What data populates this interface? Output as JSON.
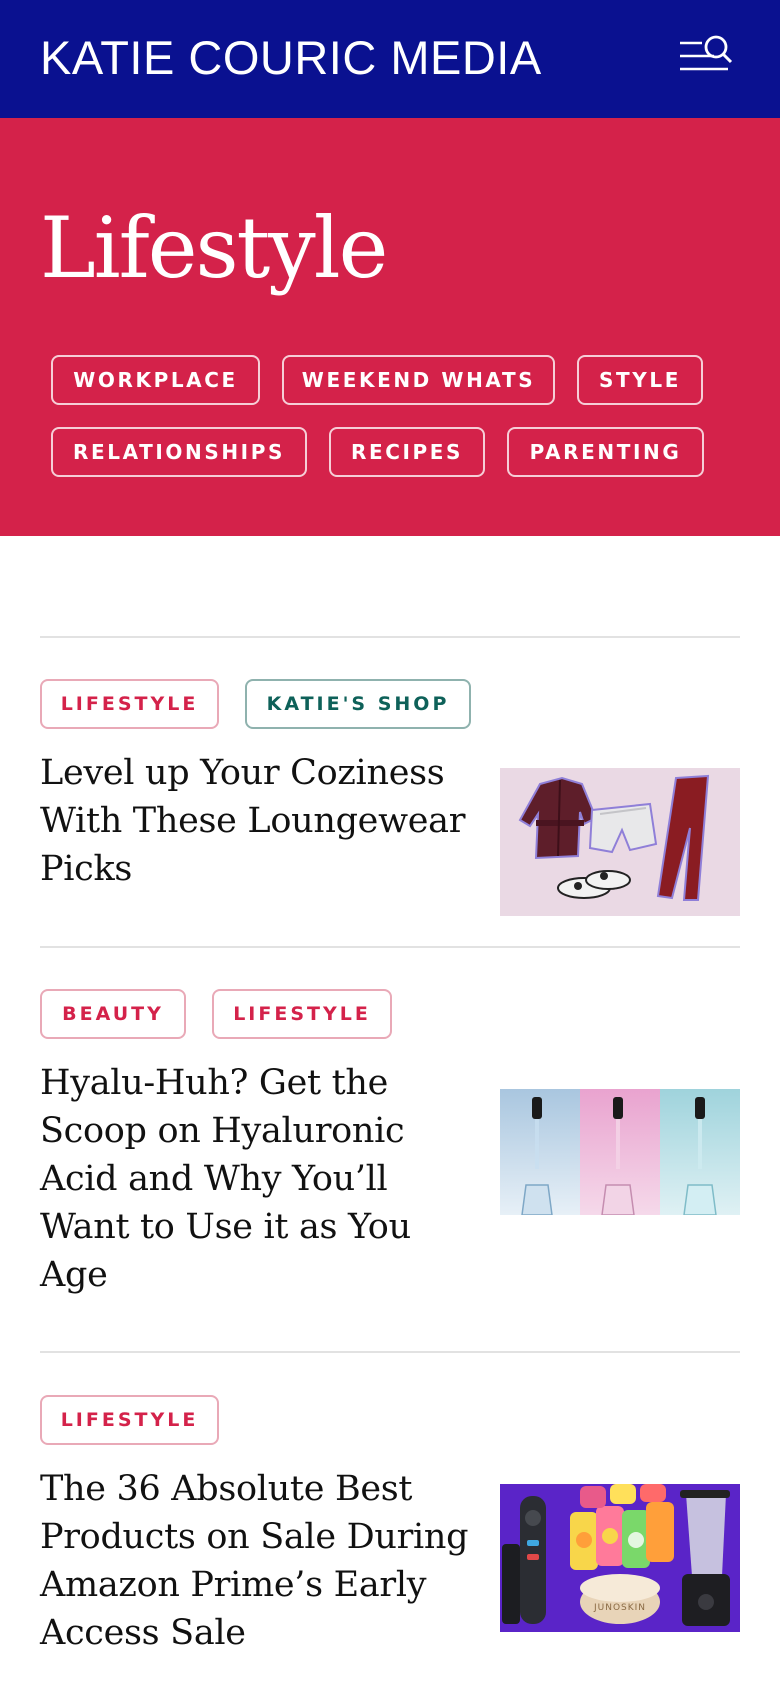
{
  "header": {
    "logo_text": "KATIE COURIC MEDIA",
    "menu_icon": "menu-search-icon",
    "background": "#0a1190"
  },
  "hero": {
    "title": "Lifestyle",
    "background": "#d4224a",
    "categories": [
      "WORKPLACE",
      "WEEKEND WHATS",
      "STYLE",
      "RELATIONSHIPS",
      "RECIPES",
      "PARENTING"
    ]
  },
  "articles": [
    {
      "tags": [
        "LIFESTYLE",
        "KATIE'S SHOP"
      ],
      "title": "Level up Your Coziness With These Loungewear Picks",
      "image": "loungewear-collage"
    },
    {
      "tags": [
        "BEAUTY",
        "LIFESTYLE"
      ],
      "title": "Hyalu-Huh? Get the Scoop on Hyaluronic Acid and Why You’ll Want to Use it as You Age",
      "image": "serum-droppers"
    },
    {
      "tags": [
        "LIFESTYLE"
      ],
      "title": "The 36 Absolute Best Products on Sale During Amazon Prime’s Early Access Sale",
      "image": "amazon-products-collage",
      "image_caption": "JUNOSKIN"
    }
  ],
  "colors": {
    "accent_red": "#d4224a",
    "navy": "#0a1190",
    "teal": "#0e6159"
  }
}
